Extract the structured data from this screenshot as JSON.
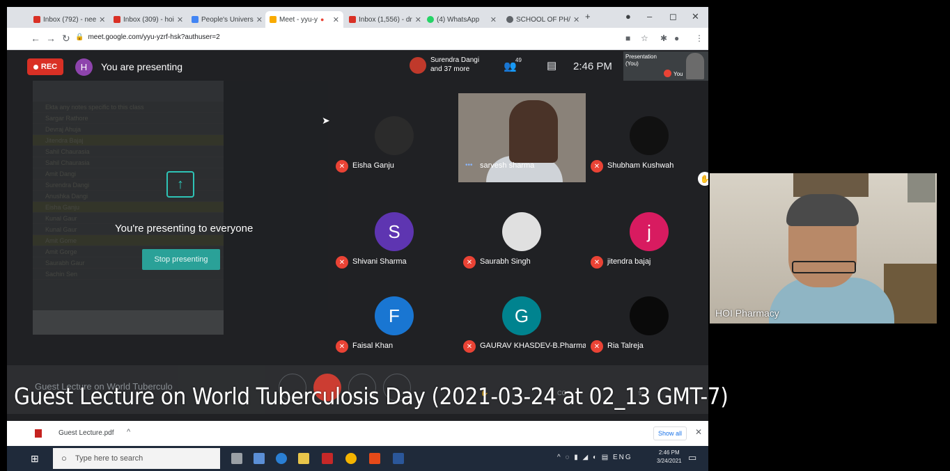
{
  "browser": {
    "tabs": [
      {
        "label": "Inbox (792) - nee",
        "color": "#d93025"
      },
      {
        "label": "Inbox (309) - hoi",
        "color": "#d93025"
      },
      {
        "label": "People's Univers",
        "color": "#4285f4"
      },
      {
        "label": "Meet - yyu-y",
        "color": "#f9ab00"
      },
      {
        "label": "Inbox (1,556) - dr",
        "color": "#d93025"
      },
      {
        "label": "(4) WhatsApp",
        "color": "#25d366"
      },
      {
        "label": "SCHOOL OF PH/",
        "color": "#5f6368"
      }
    ],
    "url": "meet.google.com/yyu-yzrf-hsk?authuser=2"
  },
  "meet": {
    "rec_label": "REC",
    "presenter_initial": "H",
    "presenting_label": "You are presenting",
    "top_participant_name": "Surendra Dangi",
    "top_participant_more": "and 37 more",
    "people_count": "49",
    "time": "2:46 PM",
    "self_tile_presentation": "Presentation",
    "self_tile_you_paren": "(You)",
    "self_tile_you": "You",
    "presenting_everyone": "You're presenting to everyone",
    "stop_presenting": "Stop presenting",
    "panel_rows": [
      "Ekta any notes specific to this class",
      "Sargar Rathore",
      "Devraj Ahuja",
      "Jitendra Bajaj",
      "Sahil Chaurasia",
      "Sahil Chaurasia",
      "Amit Dangi",
      "Surendra Dangi",
      "Anushka Dangi",
      "Eisha Ganju",
      "Kunal Gaur",
      "Kunal Gaur",
      "Amit Gome",
      "Amit Gorge",
      "Saurabh Gaur",
      "Sachin Sen"
    ],
    "meeting_title": "Guest Lecture on World Tuberculo",
    "participants": [
      {
        "name": "Eisha Ganju",
        "initial": "",
        "avatar_color": "#2b2b2b"
      },
      {
        "name": "sarvesh sharma",
        "initial": "",
        "avatar_color": "#8a8279"
      },
      {
        "name": "Shubham Kushwah",
        "initial": "",
        "avatar_color": "#111111"
      },
      {
        "name": "Shivani Sharma",
        "initial": "S",
        "avatar_color": "#5e35b1"
      },
      {
        "name": "Saurabh Singh",
        "initial": "",
        "avatar_color": "#e0e0e0"
      },
      {
        "name": "jitendra bajaj",
        "initial": "j",
        "avatar_color": "#d81b60"
      },
      {
        "name": "Faisal Khan",
        "initial": "F",
        "avatar_color": "#1976d2"
      },
      {
        "name": "GAURAV KHASDEV-B.Pharma ...",
        "initial": "G",
        "avatar_color": "#00838f"
      },
      {
        "name": "Ria Talreja",
        "initial": "",
        "avatar_color": "#0a0a0a"
      }
    ]
  },
  "downloads": {
    "file": "Guest Lecture.pdf",
    "show_all": "Show all"
  },
  "taskbar": {
    "search_placeholder": "Type here to search",
    "lang": "ENG",
    "time": "2:46 PM",
    "date": "3/24/2021"
  },
  "webcam": {
    "label": "HOI Pharmacy"
  },
  "caption": "Guest Lecture on World Tuberculosis Day (2021-03-24 at 02_13 GMT-7)"
}
